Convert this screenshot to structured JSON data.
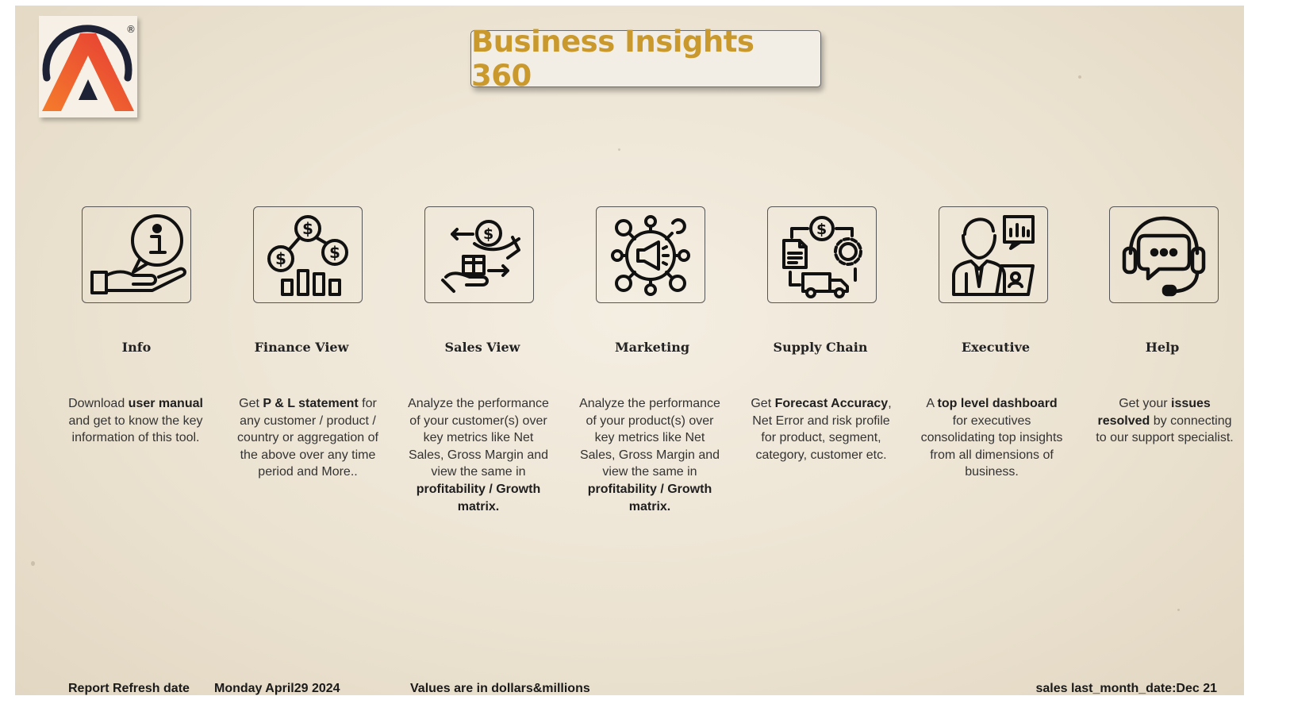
{
  "header": {
    "title": "Business Insights 360"
  },
  "logo": {
    "registered_mark": "®"
  },
  "nav": [
    {
      "id": "info",
      "label": "Info",
      "icon": "info-hand-icon",
      "description": [
        {
          "t": "Download "
        },
        {
          "t": "user manual",
          "b": true
        },
        {
          "t": " and get to know the key information of this tool."
        }
      ]
    },
    {
      "id": "finance",
      "label": "Finance View",
      "icon": "finance-chart-icon",
      "description": [
        {
          "t": "Get  "
        },
        {
          "t": "P & L statement",
          "b": true
        },
        {
          "t": " for any customer / product / country or aggregation of the above over any time period and More.."
        }
      ]
    },
    {
      "id": "sales",
      "label": "Sales View",
      "icon": "sales-exchange-icon",
      "description": [
        {
          "t": "Analyze the performance of your customer(s) over key metrics like Net Sales, Gross Margin and view the same in "
        },
        {
          "t": "profitability / Growth matrix.",
          "b": true
        }
      ]
    },
    {
      "id": "marketing",
      "label": "Marketing",
      "icon": "marketing-megaphone-icon",
      "description": [
        {
          "t": "Analyze the performance of your product(s) over key metrics like Net Sales, Gross Margin and view the same in "
        },
        {
          "t": "profitability / Growth matrix.",
          "b": true
        }
      ]
    },
    {
      "id": "supply",
      "label": "Supply Chain",
      "icon": "supply-chain-icon",
      "description": [
        {
          "t": "Get "
        },
        {
          "t": "Forecast Accuracy",
          "b": true
        },
        {
          "t": ", Net Error and risk profile for product, segment, category, customer etc."
        }
      ]
    },
    {
      "id": "executive",
      "label": "Executive",
      "icon": "executive-person-icon",
      "description": [
        {
          "t": "A "
        },
        {
          "t": "top level dashboard",
          "b": true
        },
        {
          "t": " for executives consolidating top insights from all dimensions of business."
        }
      ]
    },
    {
      "id": "help",
      "label": "Help",
      "icon": "headset-help-icon",
      "description": [
        {
          "t": "Get your "
        },
        {
          "t": "issues resolved",
          "b": true
        },
        {
          "t": " by connecting to our support specialist."
        }
      ]
    }
  ],
  "footer": {
    "refresh_label": "Report Refresh date",
    "refresh_date": "Monday April29 2024",
    "units_note": "Values are in dollars&millions",
    "sales_last_month": "sales last_month_date:Dec 21"
  },
  "colors": {
    "title": "#c9992d",
    "logo_red": "#e53935",
    "logo_orange": "#f57c2b",
    "logo_navy": "#1e2235"
  }
}
